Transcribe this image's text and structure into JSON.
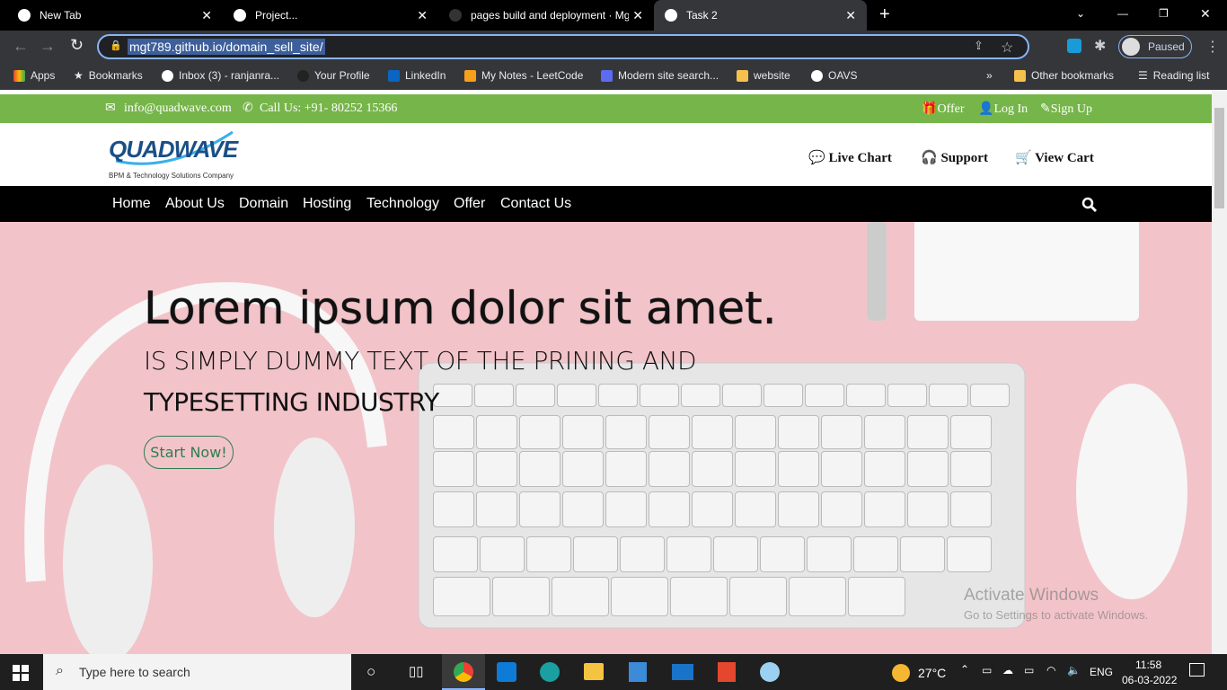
{
  "browser": {
    "tabs": [
      {
        "title": "New Tab"
      },
      {
        "title": "Project..."
      },
      {
        "title": "pages build and deployment · Mg"
      },
      {
        "title": "Task 2",
        "active": true
      }
    ],
    "url": "mgt789.github.io/domain_sell_site/",
    "profile_status": "Paused",
    "bookmarks": [
      "Apps",
      "Bookmarks",
      "Inbox (3) - ranjanra...",
      "Your Profile",
      "LinkedIn",
      "My Notes - LeetCode",
      "Modern site search...",
      "website",
      "OAVS"
    ],
    "more": "»",
    "other_bookmarks": "Other bookmarks",
    "reading_list": "Reading list"
  },
  "site": {
    "topbar": {
      "email": "info@quadwave.com",
      "phone": "Call Us: +91- 80252 15366",
      "offer": "Offer",
      "login": "Log In",
      "signup": "Sign Up"
    },
    "logo": {
      "name": "QUADWAVE",
      "tagline": "BPM & Technology Solutions Company"
    },
    "header_links": [
      "Live Chart",
      "Support",
      "View Cart"
    ],
    "nav": [
      "Home",
      "About Us",
      "Domain",
      "Hosting",
      "Technology",
      "Offer",
      "Contact Us"
    ],
    "hero": {
      "title": "Lorem ipsum dolor sit amet.",
      "subtitle1": "IS SIMPLY DUMMY TEXT OF THE PRINING AND",
      "subtitle2": "TYPESETTING INDUSTRY",
      "cta": "Start Now!"
    },
    "watermark": {
      "line1": "Activate Windows",
      "line2": "Go to Settings to activate Windows."
    }
  },
  "taskbar": {
    "search": "Type here to search",
    "temp": "27°C",
    "lang": "ENG",
    "time": "11:58",
    "date": "06-03-2022"
  },
  "colors": {
    "green": "#76b54a",
    "hero": "#f2c4c9",
    "button": "#2e7d4f"
  }
}
